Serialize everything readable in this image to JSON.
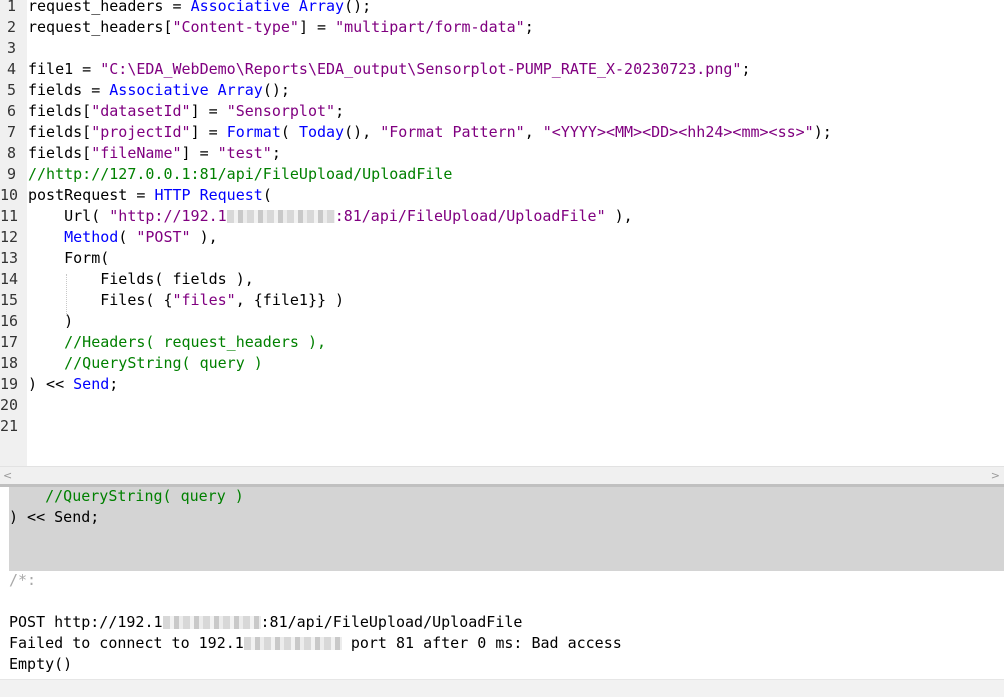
{
  "editor": {
    "lines": [
      {
        "n": "1",
        "segs": [
          {
            "t": "request_headers = ",
            "c": "plain"
          },
          {
            "t": "Associative Array",
            "c": "fn"
          },
          {
            "t": "();",
            "c": "plain"
          }
        ]
      },
      {
        "n": "2",
        "segs": [
          {
            "t": "request_headers[",
            "c": "plain"
          },
          {
            "t": "\"Content-type\"",
            "c": "str"
          },
          {
            "t": "] = ",
            "c": "plain"
          },
          {
            "t": "\"multipart/form-data\"",
            "c": "str"
          },
          {
            "t": ";",
            "c": "plain"
          }
        ]
      },
      {
        "n": "3",
        "segs": []
      },
      {
        "n": "4",
        "segs": [
          {
            "t": "file1 = ",
            "c": "plain"
          },
          {
            "t": "\"C:\\EDA_WebDemo\\Reports\\EDA_output\\Sensorplot-PUMP_RATE_X-20230723.png\"",
            "c": "str"
          },
          {
            "t": ";",
            "c": "plain"
          }
        ]
      },
      {
        "n": "5",
        "segs": [
          {
            "t": "fields = ",
            "c": "plain"
          },
          {
            "t": "Associative Array",
            "c": "fn"
          },
          {
            "t": "();",
            "c": "plain"
          }
        ]
      },
      {
        "n": "6",
        "segs": [
          {
            "t": "fields[",
            "c": "plain"
          },
          {
            "t": "\"datasetId\"",
            "c": "str"
          },
          {
            "t": "] = ",
            "c": "plain"
          },
          {
            "t": "\"Sensorplot\"",
            "c": "str"
          },
          {
            "t": ";",
            "c": "plain"
          }
        ]
      },
      {
        "n": "7",
        "segs": [
          {
            "t": "fields[",
            "c": "plain"
          },
          {
            "t": "\"projectId\"",
            "c": "str"
          },
          {
            "t": "] = ",
            "c": "plain"
          },
          {
            "t": "Format",
            "c": "fn"
          },
          {
            "t": "( ",
            "c": "plain"
          },
          {
            "t": "Today",
            "c": "fn"
          },
          {
            "t": "(), ",
            "c": "plain"
          },
          {
            "t": "\"Format Pattern\"",
            "c": "str"
          },
          {
            "t": ", ",
            "c": "plain"
          },
          {
            "t": "\"<YYYY><MM><DD><hh24><mm><ss>\"",
            "c": "str"
          },
          {
            "t": ");",
            "c": "plain"
          }
        ]
      },
      {
        "n": "8",
        "segs": [
          {
            "t": "fields[",
            "c": "plain"
          },
          {
            "t": "\"fileName\"",
            "c": "str"
          },
          {
            "t": "] = ",
            "c": "plain"
          },
          {
            "t": "\"test\"",
            "c": "str"
          },
          {
            "t": ";",
            "c": "plain"
          }
        ]
      },
      {
        "n": "9",
        "segs": [
          {
            "t": "//http://127.0.0.1:81/api/FileUpload/UploadFile",
            "c": "comment"
          }
        ]
      },
      {
        "n": "10",
        "segs": [
          {
            "t": "postRequest = ",
            "c": "plain"
          },
          {
            "t": "HTTP Request",
            "c": "fn"
          },
          {
            "t": "(",
            "c": "plain"
          }
        ]
      },
      {
        "n": "11",
        "segs": [
          {
            "t": "    ",
            "c": "plain"
          },
          {
            "t": "Url",
            "c": "plain"
          },
          {
            "t": "( ",
            "c": "plain"
          },
          {
            "t": "\"http://192.1",
            "c": "str"
          },
          {
            "t": "",
            "c": "blur",
            "w": "108"
          },
          {
            "t": ":81/api/FileUpload/UploadFile\"",
            "c": "str"
          },
          {
            "t": " ),",
            "c": "plain"
          }
        ]
      },
      {
        "n": "12",
        "segs": [
          {
            "t": "    ",
            "c": "plain"
          },
          {
            "t": "Method",
            "c": "fn"
          },
          {
            "t": "( ",
            "c": "plain"
          },
          {
            "t": "\"POST\"",
            "c": "str"
          },
          {
            "t": " ),",
            "c": "plain"
          }
        ]
      },
      {
        "n": "13",
        "segs": [
          {
            "t": "    Form(",
            "c": "plain"
          }
        ]
      },
      {
        "n": "14",
        "segs": [
          {
            "t": "        Fields( fields ),",
            "c": "plain"
          }
        ]
      },
      {
        "n": "15",
        "segs": [
          {
            "t": "        Files( {",
            "c": "plain"
          },
          {
            "t": "\"files\"",
            "c": "str"
          },
          {
            "t": ", {file1}} )",
            "c": "plain"
          }
        ]
      },
      {
        "n": "16",
        "segs": [
          {
            "t": "    )",
            "c": "plain"
          }
        ]
      },
      {
        "n": "17",
        "segs": [
          {
            "t": "    //Headers( request_headers ),",
            "c": "comment"
          }
        ]
      },
      {
        "n": "18",
        "segs": [
          {
            "t": "    //QueryString( query )",
            "c": "comment"
          }
        ]
      },
      {
        "n": "19",
        "segs": [
          {
            "t": ") << ",
            "c": "plain"
          },
          {
            "t": "Send",
            "c": "fn"
          },
          {
            "t": ";",
            "c": "plain"
          }
        ]
      },
      {
        "n": "20",
        "segs": []
      },
      {
        "n": "21",
        "segs": []
      }
    ]
  },
  "scroll": {
    "left_arrow": "<",
    "right_arrow": ">"
  },
  "log": {
    "echo_lines": [
      [
        {
          "t": "    //QueryString( query )",
          "c": "comment"
        }
      ],
      [
        {
          "t": ") << Send;",
          "c": "plain"
        }
      ]
    ],
    "comment_open": "/*:",
    "output_lines": [
      [
        {
          "t": "POST http://192.1",
          "c": "plain"
        },
        {
          "t": "",
          "c": "blur",
          "w": "98"
        },
        {
          "t": ":81/api/FileUpload/UploadFile",
          "c": "plain"
        }
      ],
      [
        {
          "t": "Failed to connect to 192.1",
          "c": "plain"
        },
        {
          "t": "",
          "c": "blur",
          "w": "98"
        },
        {
          "t": " port 81 after 0 ms: Bad access",
          "c": "plain"
        }
      ],
      [
        {
          "t": "Empty()",
          "c": "plain"
        }
      ]
    ]
  }
}
